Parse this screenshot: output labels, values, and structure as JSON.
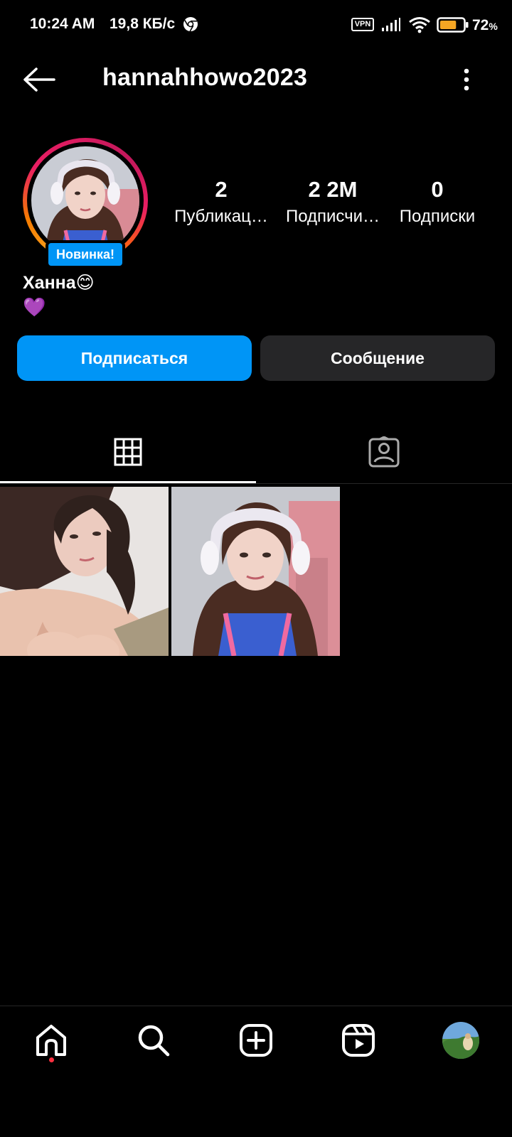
{
  "status_bar": {
    "time": "10:24 AM",
    "speed": "19,8 КБ/с",
    "vpn": "VPN",
    "battery": "72",
    "battery_unit": "%",
    "battery_level": 0.72,
    "icons": [
      "chrome-icon",
      "signal-icon",
      "wifi-icon",
      "battery-icon"
    ]
  },
  "header": {
    "username": "hannahhowo2023",
    "icons": [
      "arrow-left-icon",
      "more-vertical-icon"
    ]
  },
  "profile": {
    "badge": "Новинка!",
    "display_name": "Ханна😊",
    "bio": "💜",
    "stats": [
      {
        "value": "2",
        "label": "Публикац…"
      },
      {
        "value": "2 2M",
        "label": "Подписчи…"
      },
      {
        "value": "0",
        "label": "Подписки"
      }
    ]
  },
  "actions": {
    "follow": "Подписаться",
    "message": "Сообщение"
  },
  "tabs": [
    {
      "icon": "grid-icon",
      "selected": true
    },
    {
      "icon": "tagged-user-icon",
      "selected": false
    }
  ],
  "colors": {
    "background": "#000000",
    "accent": "#0095f6",
    "secondary_button": "#262628",
    "notification": "#ff3040"
  },
  "bottom_nav": {
    "icons": [
      "home-icon",
      "search-icon",
      "create-icon",
      "reels-icon",
      "profile-avatar"
    ],
    "home_has_notification": true
  }
}
